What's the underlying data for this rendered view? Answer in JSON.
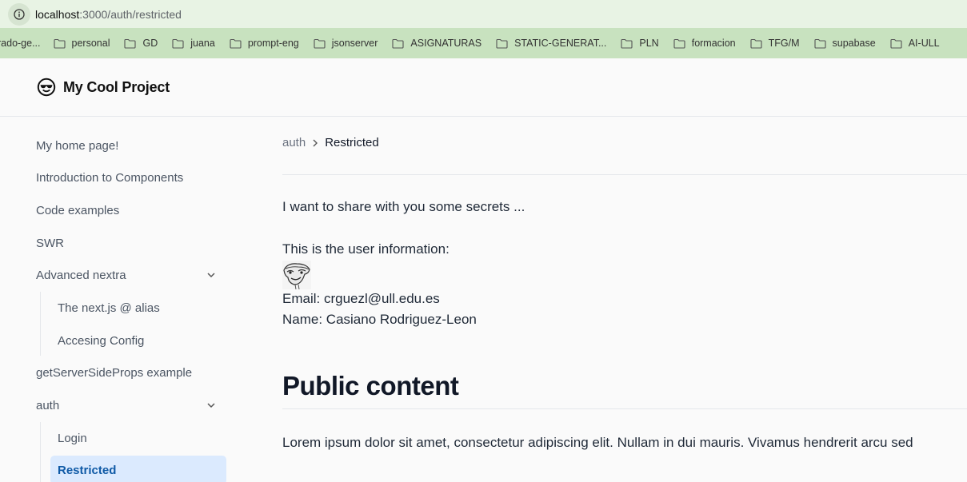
{
  "browser": {
    "url_host": "localhost",
    "url_rest": ":3000/auth/restricted",
    "bookmarks": [
      {
        "label": "rado-ge..."
      },
      {
        "label": "personal"
      },
      {
        "label": "GD"
      },
      {
        "label": "juana"
      },
      {
        "label": "prompt-eng"
      },
      {
        "label": "jsonserver"
      },
      {
        "label": "ASIGNATURAS"
      },
      {
        "label": "STATIC-GENERAT..."
      },
      {
        "label": "PLN"
      },
      {
        "label": "formacion"
      },
      {
        "label": "TFG/M"
      },
      {
        "label": "supabase"
      },
      {
        "label": "AI-ULL"
      }
    ]
  },
  "header": {
    "title": "My Cool Project",
    "logo_icon": "sunglasses-face-icon"
  },
  "sidebar": {
    "items": [
      {
        "label": "My home page!"
      },
      {
        "label": "Introduction to Components"
      },
      {
        "label": "Code examples"
      },
      {
        "label": "SWR"
      },
      {
        "label": "Advanced nextra"
      },
      {
        "label": "The next.js @ alias"
      },
      {
        "label": "Accesing Config"
      },
      {
        "label": "getServerSideProps example"
      },
      {
        "label": "auth"
      },
      {
        "label": "Login"
      },
      {
        "label": "Restricted"
      }
    ]
  },
  "main": {
    "breadcrumb": [
      "auth",
      "Restricted"
    ],
    "intro": "I want to share with you some secrets ...",
    "user_info_label": "This is the user information:",
    "email": "Email: crguezl@ull.edu.es",
    "name": "Name: Casiano Rodriguez-Leon",
    "heading": "Public content",
    "lorem": "Lorem ipsum dolor sit amet, consectetur adipiscing elit. Nullam in dui mauris. Vivamus hendrerit arcu sed"
  },
  "colors": {
    "active_bg": "#dbeafe",
    "active_text": "#0f5aa6",
    "urlbar_bg": "#e8f3e4",
    "bookmarks_bg": "#c8e2bf"
  }
}
